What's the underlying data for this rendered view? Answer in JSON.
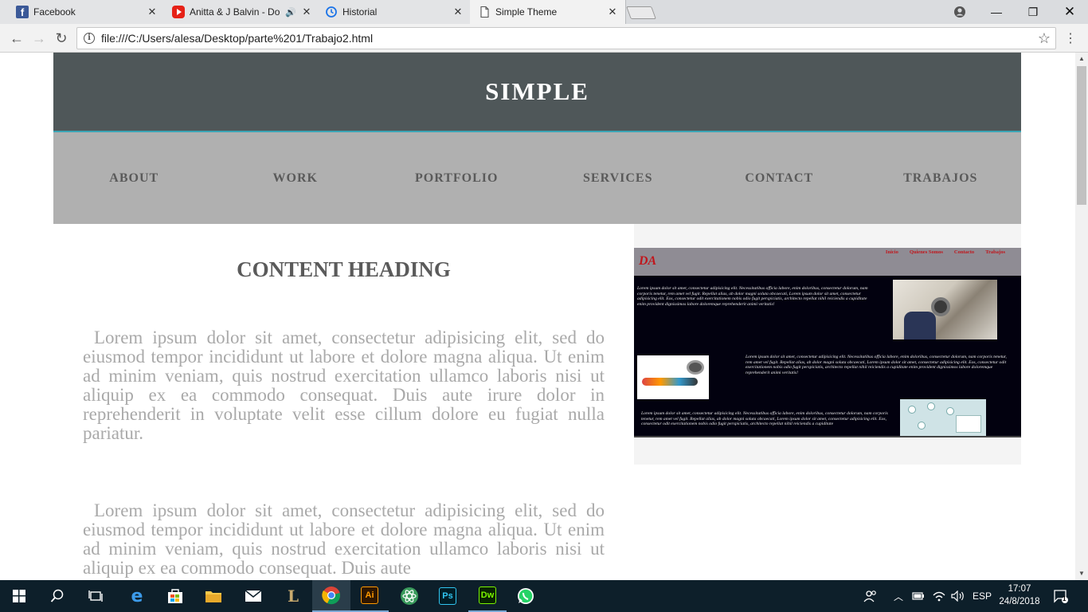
{
  "browser": {
    "tabs": [
      {
        "title": "Facebook",
        "icon": "facebook-icon"
      },
      {
        "title": "Anitta & J Balvin - Do",
        "icon": "youtube-icon",
        "audio_icon": "speaker-icon"
      },
      {
        "title": "Historial",
        "icon": "history-icon"
      },
      {
        "title": "Simple Theme",
        "icon": "document-icon",
        "active": true
      }
    ],
    "address": "file:///C:/Users/alesa/Desktop/parte%201/Trabajo2.html"
  },
  "site": {
    "title": "SIMPLE",
    "nav": [
      "ABOUT",
      "WORK",
      "PORTFOLIO",
      "SERVICES",
      "CONTACT",
      "TRABAJOS"
    ],
    "content_heading": "CONTENT HEADING",
    "paragraphs": [
      "Lorem ipsum dolor sit amet, consectetur adipisicing elit, sed do eiusmod tempor incididunt ut labore et dolore magna aliqua. Ut enim ad minim veniam, quis nostrud exercitation ullamco laboris nisi ut aliquip ex ea commodo consequat. Duis aute irure dolor in reprehenderit in voluptate velit esse cillum dolore eu fugiat nulla pariatur.",
      "Lorem ipsum dolor sit amet, consectetur adipisicing elit, sed do eiusmod tempor incididunt ut labore et dolore magna aliqua. Ut enim ad minim veniam, quis nostrud exercitation ullamco laboris nisi ut aliquip ex ea commodo consequat. Duis aute"
    ],
    "preview": {
      "logo": "DA",
      "links": [
        "Inicio",
        "Quienes Somos",
        "Contacto",
        "Trabajos"
      ],
      "text1": "Lorem ipsum dolor sit amet, consectetur adipisicing elit. Necessitatibus officia labore, enim doloribus, consectetur dolorum, nam corporis tenetur, rem amet vel fugit. Repellat alias, ab dolor magni soluta obcaecati, Lorem ipsum dolor sit amet, consectetur adipisicing elit. Eos, consectetur odit exercitationem nobis odio fugit perspiciatis, architecto repellat nihil reiciendis a cupiditate enim provident dignissimos labore doloremque reprehenderit animi veritatis!",
      "text2": "Lorem ipsum dolor sit amet, consectetur adipisicing elit. Necessitatibus officia labore, enim doloribus, consectetur dolorum, nam corporis tenetur, rem amet vel fugit. Repellat alias, ab dolor magni soluta obcaecati, Lorem ipsum dolor sit amet, consectetur adipisicing elit. Eos, consectetur odit exercitationem nobis odio fugit perspiciatis, architecto repellat nihil reiciendis a cupiditate enim provident dignissimos labore doloremque reprehenderit animi veritatis!",
      "text3": "Lorem ipsum dolor sit amet, consectetur adipisicing elit. Necessitatibus officia labore, enim doloribus, consectetur dolorum, nam corporis tenetur, rem amet vel fugit. Repellat alias, ab dolor magni soluta obcaecati, Lorem ipsum dolor sit amet, consectetur adipisicing elit. Eos, consectetur odit exercitationem nobis odio fugit perspiciatis, architecto repellat nihil reiciendis a cupiditate"
    }
  },
  "taskbar": {
    "apps": [
      "start-icon",
      "search-icon",
      "task-view-icon",
      "edge-icon",
      "store-icon",
      "file-explorer-icon",
      "mail-icon",
      "league-of-legends-icon",
      "chrome-icon",
      "illustrator-icon",
      "atom-icon",
      "photoshop-icon",
      "dreamweaver-icon",
      "whatsapp-icon"
    ],
    "app_labels": {
      "illustrator": "Ai",
      "photoshop": "Ps",
      "dreamweaver": "Dw"
    },
    "language": "ESP",
    "time": "17:07",
    "date": "24/8/2018",
    "notification_count": "1"
  },
  "colors": {
    "site_header": "#4f5759",
    "site_header_border": "#3ba5b5",
    "site_nav": "#b0b0b0",
    "paragraph_text": "#a9a9a9",
    "heading_text": "#5a5a5a"
  }
}
